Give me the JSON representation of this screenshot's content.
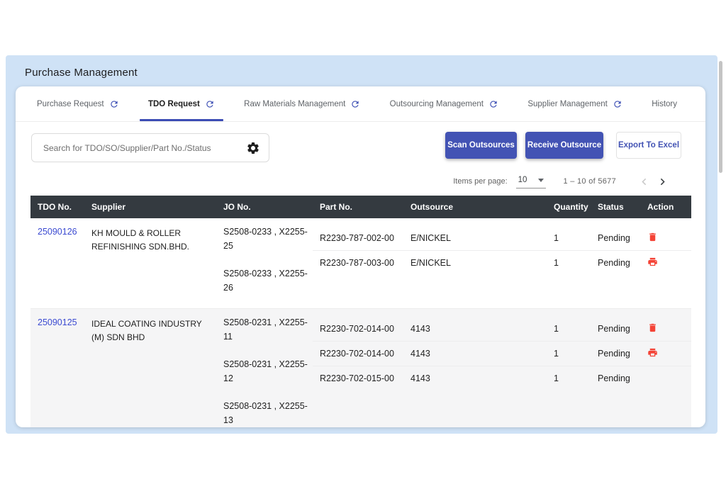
{
  "page": {
    "title": "Purchase Management"
  },
  "tabs": [
    {
      "label": "Purchase Request",
      "icon": "refresh",
      "active": false
    },
    {
      "label": "TDO Request",
      "icon": "refresh",
      "active": true
    },
    {
      "label": "Raw Materials Management",
      "icon": "refresh",
      "active": false
    },
    {
      "label": "Outsourcing Management",
      "icon": "refresh",
      "active": false
    },
    {
      "label": "Supplier Management",
      "icon": "refresh",
      "active": false
    },
    {
      "label": "History",
      "icon": null,
      "active": false
    }
  ],
  "search": {
    "placeholder": "Search for TDO/SO/Supplier/Part No./Status",
    "icon": "settings"
  },
  "toolbar": {
    "scan_label": "Scan Outsources",
    "receive_label": "Receive Outsource",
    "export_label": "Export To Excel"
  },
  "pagination": {
    "items_per_page_label": "Items per page:",
    "items_per_page": "10",
    "range": "1 – 10 of 5677",
    "prev_icon": "chevron-left",
    "next_icon": "chevron-right"
  },
  "table": {
    "columns": [
      "TDO No.",
      "Supplier",
      "JO No.",
      "Part No.",
      "Outsource",
      "Quantity",
      "Status",
      "Action"
    ],
    "rows": [
      {
        "tdo_no": "25090126",
        "supplier": "KH MOULD & ROLLER REFINISHING SDN.BHD.",
        "jo_nos": [
          "S2508-0233 , X2255-25",
          "S2508-0233 , X2255-26"
        ],
        "parts": [
          {
            "part_no": "R2230-787-002-00",
            "outsource": "E/NICKEL",
            "quantity": "1",
            "status": "Pending"
          },
          {
            "part_no": "R2230-787-003-00",
            "outsource": "E/NICKEL",
            "quantity": "1",
            "status": "Pending"
          }
        ],
        "actions": [
          "delete",
          "print"
        ]
      },
      {
        "tdo_no": "25090125",
        "supplier": "IDEAL COATING INDUSTRY (M) SDN BHD",
        "jo_nos": [
          "S2508-0231 , X2255-11",
          "S2508-0231 , X2255-12",
          "S2508-0231 , X2255-13"
        ],
        "parts": [
          {
            "part_no": "R2230-702-014-00",
            "outsource": "4143",
            "quantity": "1",
            "status": "Pending"
          },
          {
            "part_no": "R2230-702-014-00",
            "outsource": "4143",
            "quantity": "1",
            "status": "Pending"
          },
          {
            "part_no": "R2230-702-015-00",
            "outsource": "4143",
            "quantity": "1",
            "status": "Pending"
          }
        ],
        "actions": [
          "delete",
          "print"
        ]
      }
    ]
  },
  "colors": {
    "panel_blue": "#cfe2f6",
    "accent_indigo": "#4353b4",
    "tab_indicator": "#3c4db5",
    "link_blue": "#3b4ad1",
    "danger_red": "#f44336",
    "table_header_bg": "#343a40",
    "row_alt_bg": "#f5f5f6"
  }
}
